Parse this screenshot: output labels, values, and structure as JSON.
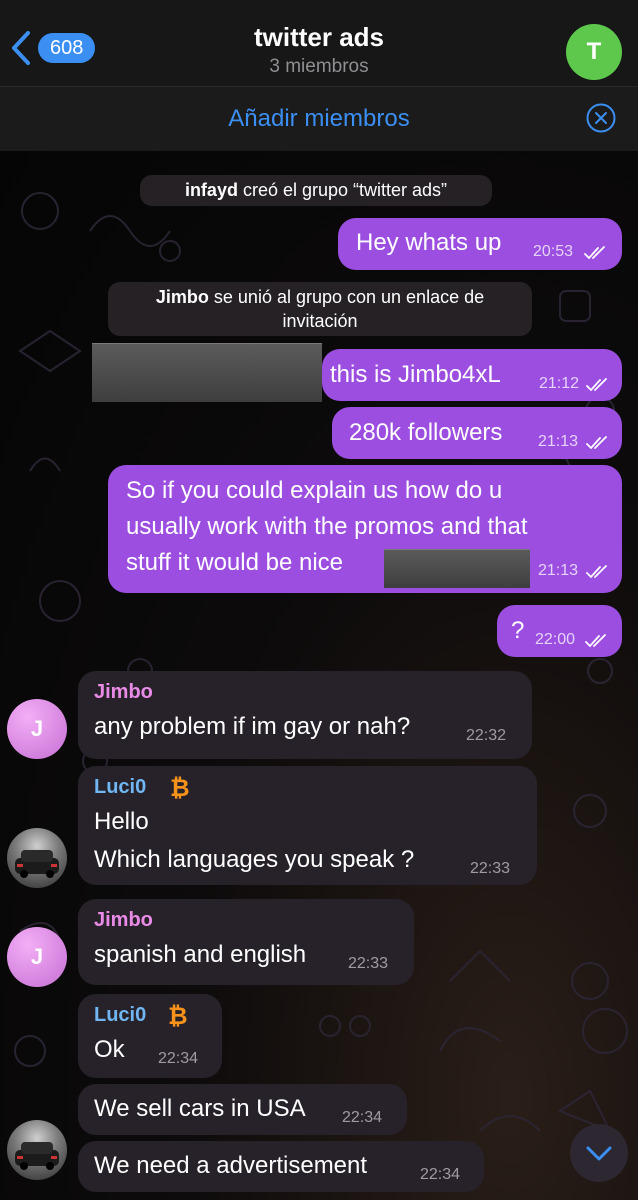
{
  "header": {
    "back_count": "608",
    "title": "twitter ads",
    "subtitle": "3 miembros",
    "avatar_letter": "T"
  },
  "add_bar": {
    "label": "Añadir miembros"
  },
  "messages": {
    "sys1": {
      "name": "infayd",
      "text": " creó el grupo “twitter ads”"
    },
    "m1": {
      "text": "Hey whats up",
      "time": "20:53"
    },
    "sys2": {
      "name": "Jimbo",
      "text": " se unió al grupo con un enlace de",
      "text2": "invitación"
    },
    "m2": {
      "text": "this is Jimbo4xL",
      "time": "21:12"
    },
    "m3": {
      "text": "280k followers",
      "time": "21:13"
    },
    "m4": {
      "line1": "So if you could explain us how do u",
      "line2": "usually work with the promos and that",
      "line3": "stuff it would be nice",
      "time": "21:13"
    },
    "m5": {
      "text": "?",
      "time": "22:00"
    },
    "m6": {
      "name": "Jimbo",
      "text": "any problem if im gay or nah?",
      "time": "22:32",
      "avatar": "J"
    },
    "m7": {
      "name": "Luci0",
      "line1": "Hello",
      "line2": "Which languages you speak ?",
      "time": "22:33"
    },
    "m8": {
      "name": "Jimbo",
      "text": "spanish and english",
      "time": "22:33",
      "avatar": "J"
    },
    "m9": {
      "name": "Luci0",
      "text": "Ok",
      "time": "22:34"
    },
    "m10": {
      "text": "We sell cars in USA",
      "time": "22:34"
    },
    "m11": {
      "text": "We need a advertisement",
      "time": "22:34"
    }
  },
  "colors": {
    "accent": "#3b8ff3",
    "outgoing_bubble": "#9b4ee0",
    "incoming_bubble": "#27222a",
    "jimbo_name": "#e98be6",
    "luci_name": "#6fb6f2",
    "bitcoin": "#f7931a"
  },
  "icons": [
    "back-chevron-icon",
    "close-icon",
    "read-ticks-icon",
    "bitcoin-icon",
    "chevron-down-icon"
  ]
}
